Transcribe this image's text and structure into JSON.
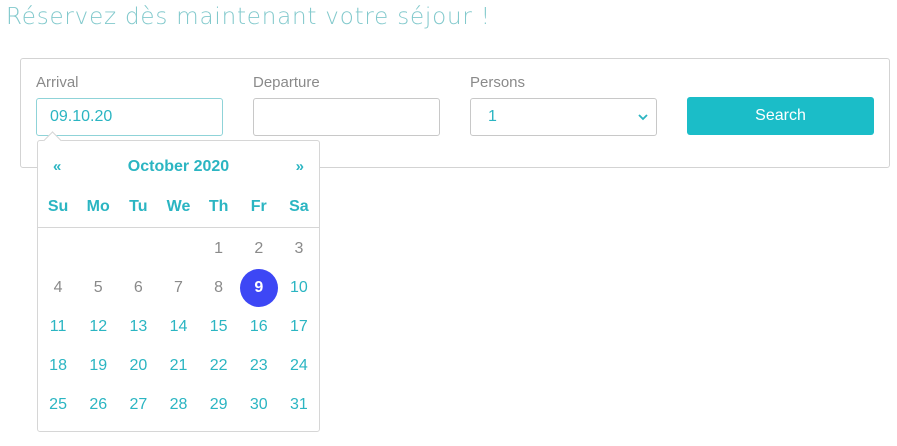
{
  "heading": "Réservez dès maintenant votre séjour !",
  "form": {
    "arrival_label": "Arrival",
    "arrival_value": "09.10.20",
    "departure_label": "Departure",
    "departure_value": "",
    "persons_label": "Persons",
    "persons_value": "1",
    "search_label": "Search"
  },
  "datepicker": {
    "prev": "«",
    "next": "»",
    "title": "October 2020",
    "weekdays": [
      "Su",
      "Mo",
      "Tu",
      "We",
      "Th",
      "Fr",
      "Sa"
    ],
    "weeks": [
      [
        "",
        "",
        "",
        "",
        "1",
        "2",
        "3"
      ],
      [
        "4",
        "5",
        "6",
        "7",
        "8",
        "9",
        "10"
      ],
      [
        "11",
        "12",
        "13",
        "14",
        "15",
        "16",
        "17"
      ],
      [
        "18",
        "19",
        "20",
        "21",
        "22",
        "23",
        "24"
      ],
      [
        "25",
        "26",
        "27",
        "28",
        "29",
        "30",
        "31"
      ]
    ],
    "selected_day": "9",
    "past_through_day": 9
  },
  "colors": {
    "accent": "#2bb5c2",
    "button": "#1bbdc8",
    "selected": "#3d47f5",
    "heading": "#82c9cc",
    "muted": "#8a8a8a"
  },
  "icons": {
    "calendar": "calendar-icon",
    "select_caret": "chevron-down-icon"
  }
}
